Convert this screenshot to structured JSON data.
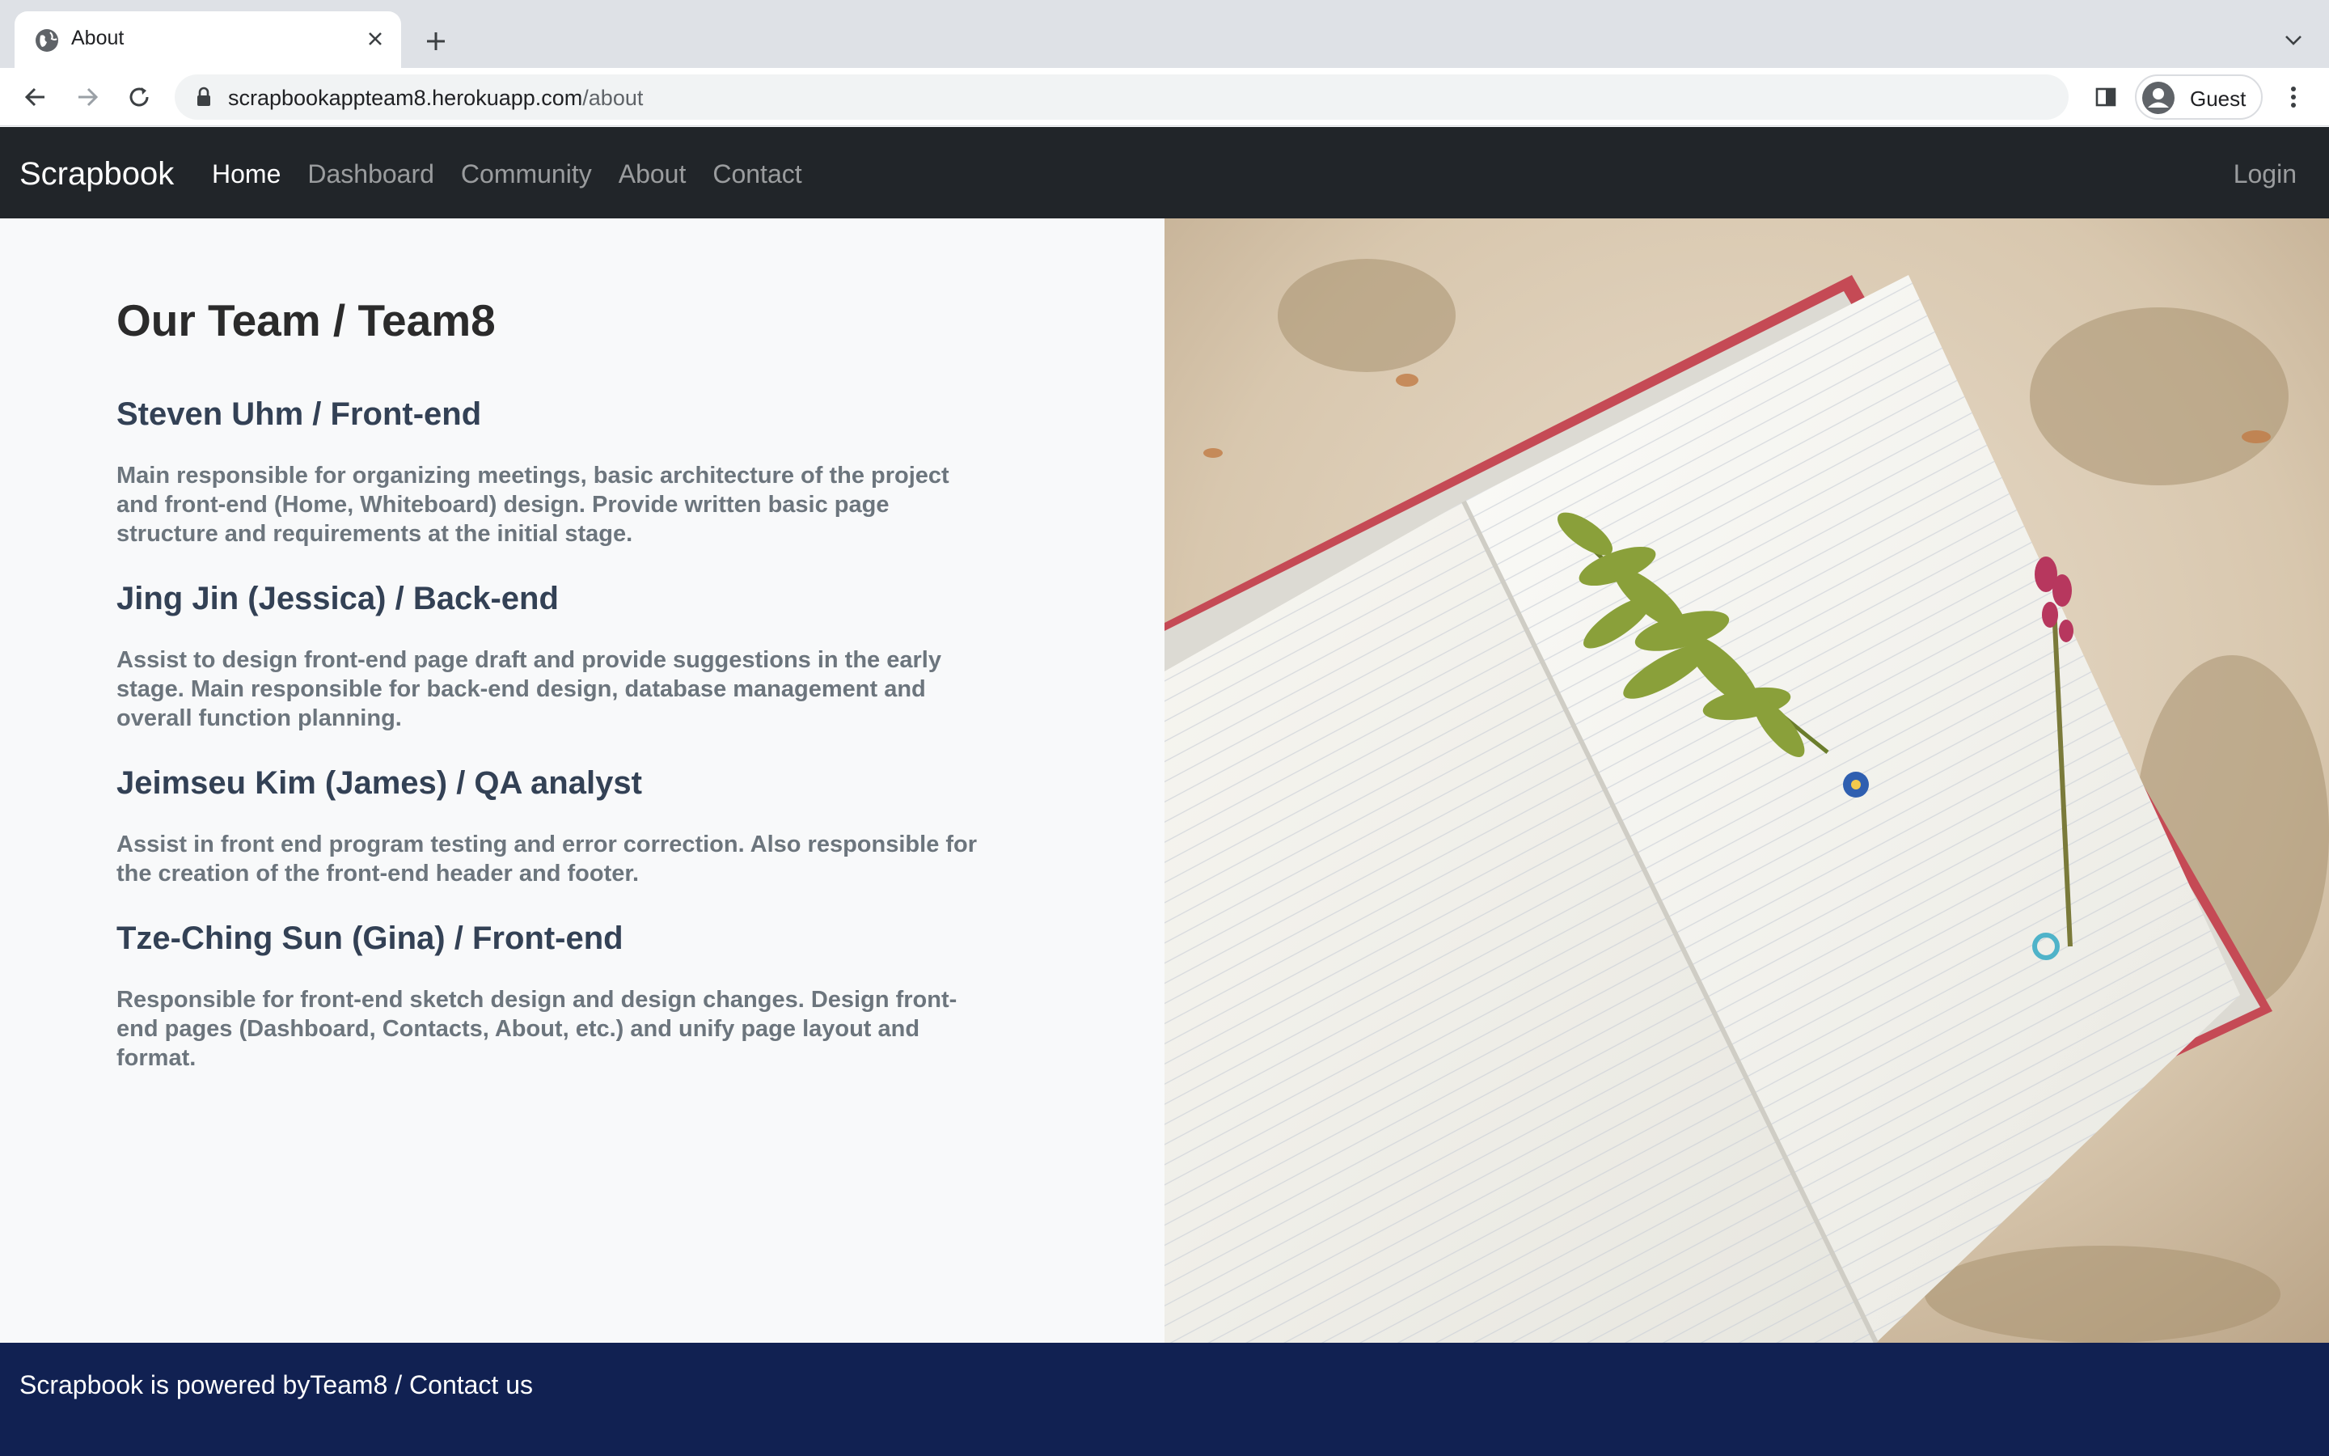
{
  "browser": {
    "tab_title": "About",
    "url_host": "scrapbookappteam8.herokuapp.com",
    "url_path": "/about",
    "profile_name": "Guest"
  },
  "navbar": {
    "brand": "Scrapbook",
    "links": [
      "Home",
      "Dashboard",
      "Community",
      "About",
      "Contact"
    ],
    "active": "Home",
    "login": "Login"
  },
  "main": {
    "title": "Our Team / Team8",
    "members": [
      {
        "name": "Steven Uhm / Front-end",
        "desc": "Main responsible for organizing meetings, basic architecture of the project and front-end (Home, Whiteboard) design. Provide written basic page structure and requirements at the initial stage."
      },
      {
        "name": "Jing Jin (Jessica) / Back-end",
        "desc": "Assist to design front-end page draft and provide suggestions in the early stage. Main responsible for back-end design, database management and overall function planning."
      },
      {
        "name": "Jeimseu Kim (James) / QA analyst",
        "desc": "Assist in front end program testing and error correction. Also responsible for the creation of the front-end header and footer."
      },
      {
        "name": "Tze-Ching Sun (Gina) / Front-end",
        "desc": "Responsible for front-end sketch design and design changes. Design front-end pages (Dashboard, Contacts, About, etc.) and unify page layout and format."
      }
    ]
  },
  "footer": {
    "text": "Scrapbook is powered byTeam8 / Contact us"
  },
  "colors": {
    "navbar_bg": "#212529",
    "footer_bg": "#112152",
    "page_bg": "#f8f9fa"
  }
}
